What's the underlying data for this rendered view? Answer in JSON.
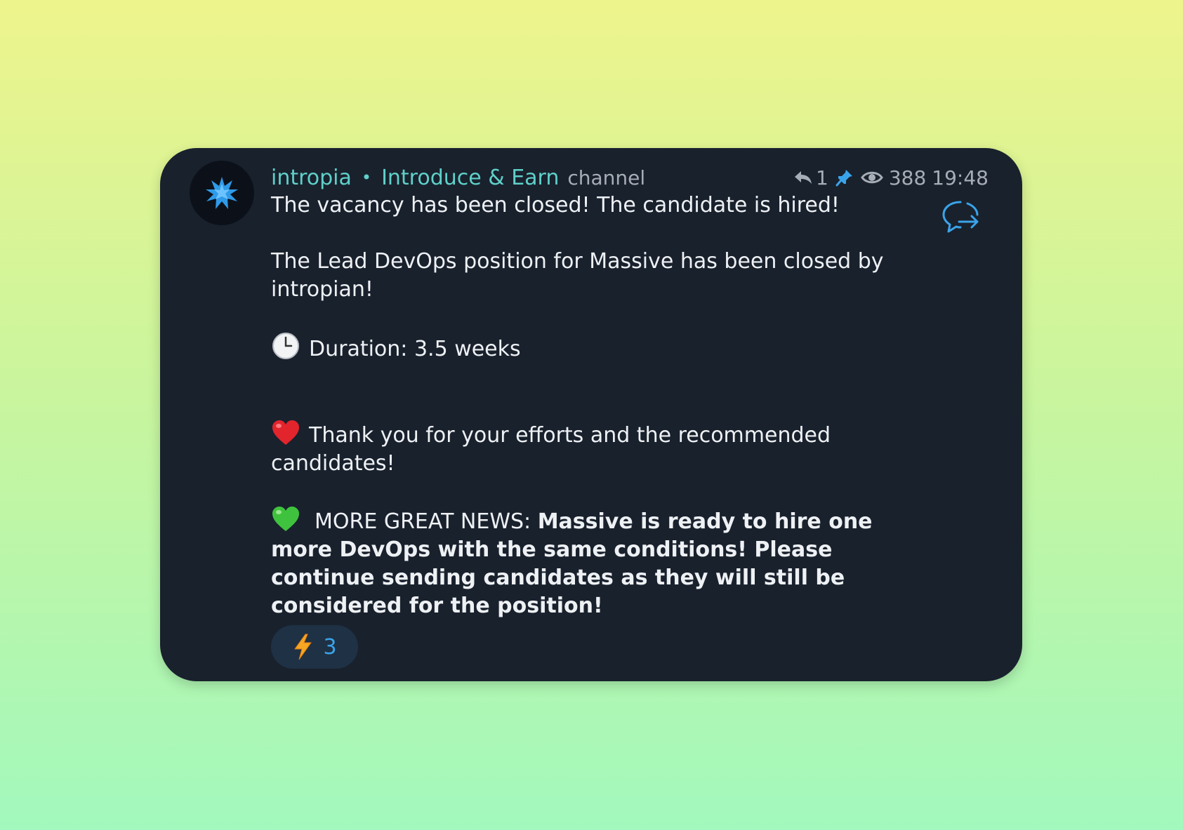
{
  "message": {
    "sender": "intropia",
    "separator": "•",
    "channel_name": "Introduce & Earn",
    "channel_tag": "channel",
    "reply_count": "1",
    "views": "388",
    "time": "19:48",
    "lines": {
      "headline": "The vacancy has been closed! The candidate is hired!",
      "position": "The Lead DevOps position for Massive has been closed by intropian!",
      "duration": "Duration: 3.5 weeks",
      "thanks": "Thank you for your efforts and the recommended candidates!",
      "news_prefix": "MORE GREAT NEWS:",
      "news_bold": "Massive is ready to hire one more DevOps with the same conditions! Please continue sending candidates as they will still be considered for the position!"
    },
    "reaction": {
      "icon": "lightning-icon",
      "count": "3"
    }
  },
  "colors": {
    "card_bg": "#19212d",
    "accent_teal": "#5fd0c9",
    "accent_blue": "#3aa4ea",
    "meta_gray": "#a6adb6",
    "text": "#eef1f4"
  }
}
